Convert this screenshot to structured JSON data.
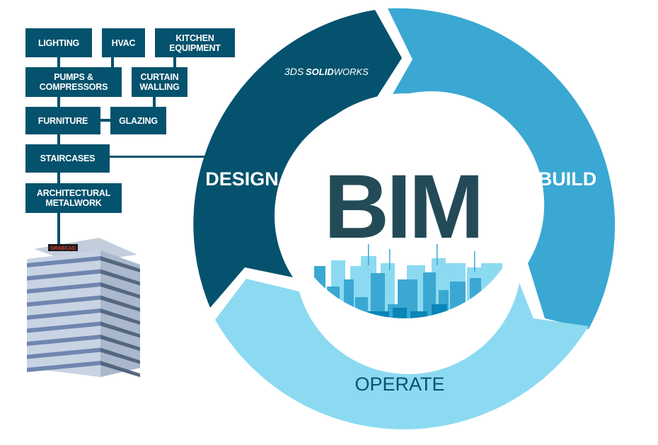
{
  "diagram": {
    "title": "BIM",
    "brand": {
      "logo_mark": "3DS",
      "name_bold": "SOLID",
      "name_light": "WORKS"
    },
    "phases": [
      {
        "id": "design",
        "label": "DESIGN",
        "color": "#04526d",
        "text_color": "#ffffff"
      },
      {
        "id": "build",
        "label": "BUILD",
        "color": "#3aa8d2",
        "text_color": "#ffffff"
      },
      {
        "id": "operate",
        "label": "OPERATE",
        "color": "#8cdaf1",
        "text_color": "#04526d"
      }
    ],
    "components": [
      {
        "id": "lighting",
        "label": "LIGHTING"
      },
      {
        "id": "hvac",
        "label": "HVAC"
      },
      {
        "id": "kitchen-equipment",
        "label": "KITCHEN\nEQUIPMENT"
      },
      {
        "id": "pumps-compressors",
        "label": "PUMPS &\nCOMPRESSORS"
      },
      {
        "id": "curtain-walling",
        "label": "CURTAIN\nWALLING"
      },
      {
        "id": "furniture",
        "label": "FURNITURE"
      },
      {
        "id": "glazing",
        "label": "GLAZING"
      },
      {
        "id": "staircases",
        "label": "STAIRCASES"
      },
      {
        "id": "architectural-metalwork",
        "label": "ARCHITECTURAL\nMETALWORK"
      }
    ],
    "building_sign": "GRABCAD",
    "colors": {
      "box": "#04526d",
      "bim_text": "#234b57",
      "skyline_light": "#8cdaf1",
      "skyline_mid": "#3aa8d2",
      "skyline_dark": "#0a85b8",
      "skyline_darkest": "#04526d"
    }
  }
}
